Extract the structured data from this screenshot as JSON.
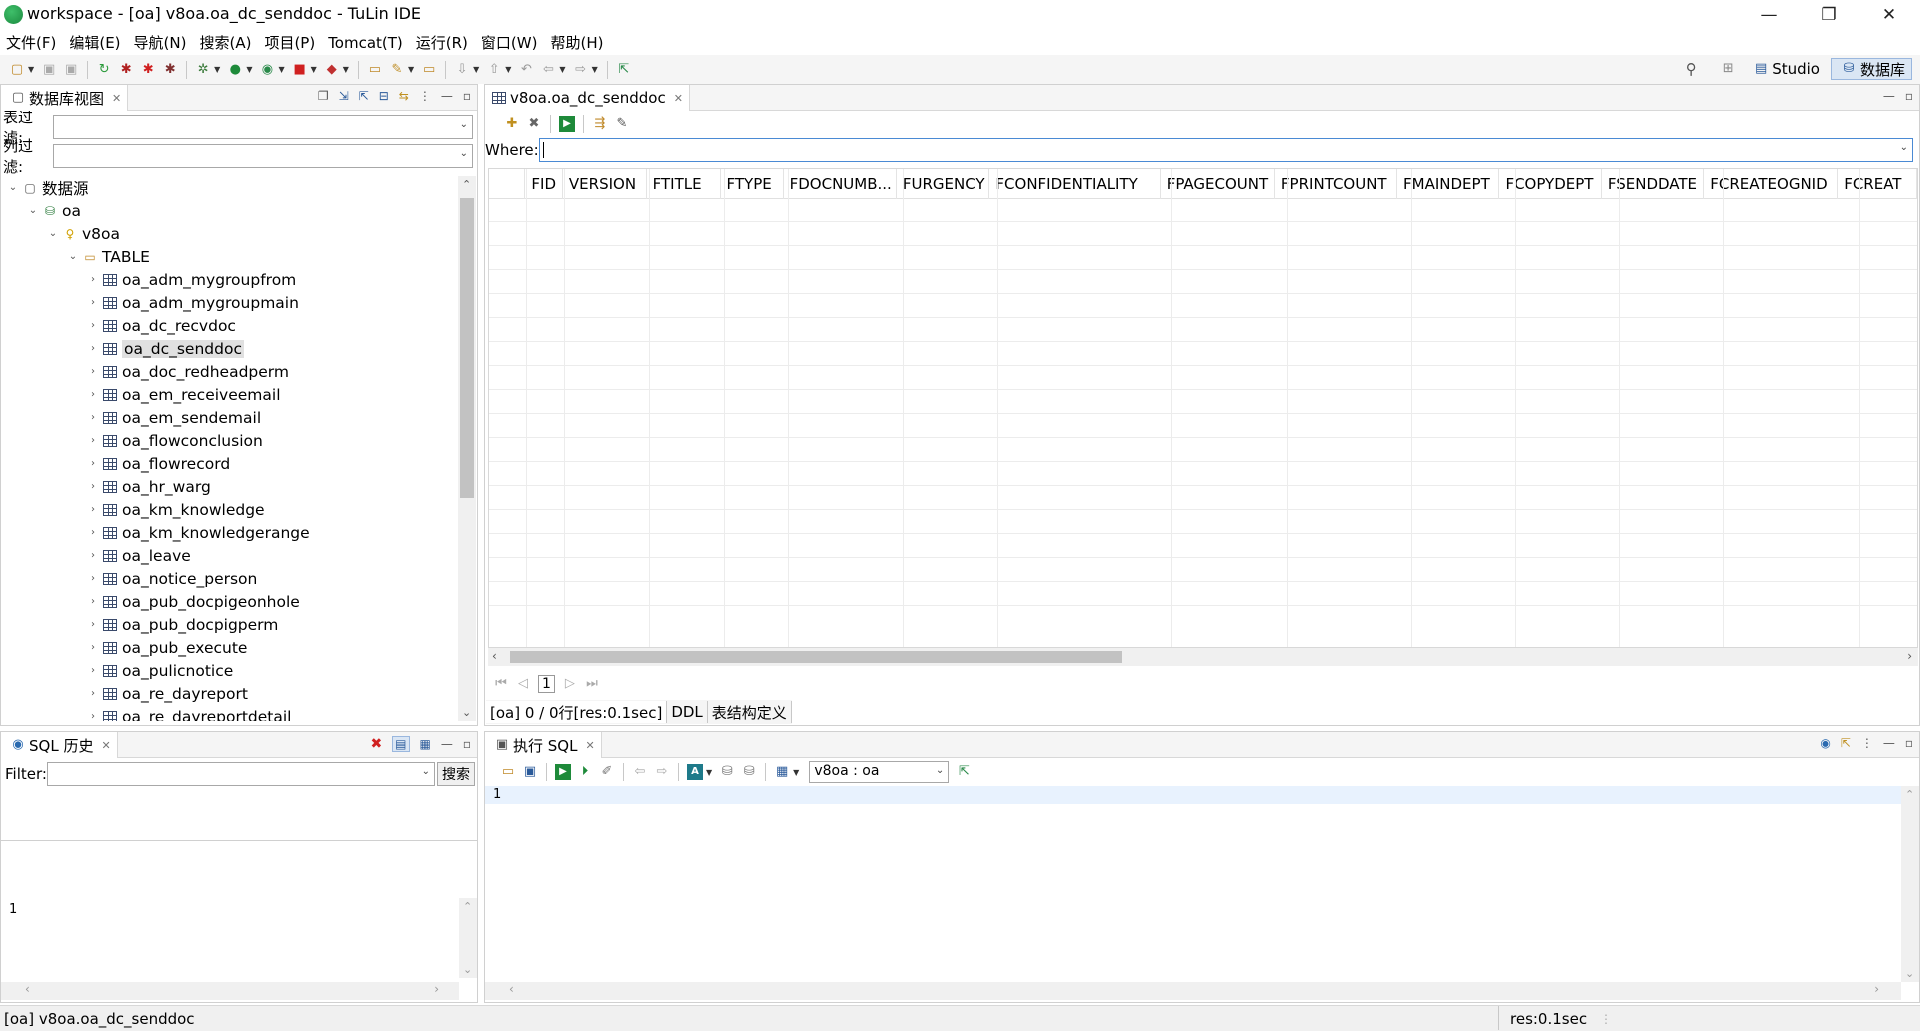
{
  "window": {
    "title": "workspace - [oa] v8oa.oa_dc_senddoc - TuLin IDE",
    "minimize": "—",
    "restore": "❐",
    "close": "✕"
  },
  "menu": [
    "文件(F)",
    "编辑(E)",
    "导航(N)",
    "搜索(A)",
    "项目(P)",
    "Tomcat(T)",
    "运行(R)",
    "窗口(W)",
    "帮助(H)"
  ],
  "perspectives": {
    "studio": "Studio",
    "database": "数据库"
  },
  "db_view": {
    "tab_label": "数据库视图",
    "table_filter_label": "表过滤:",
    "column_filter_label": "列过滤:",
    "tree": {
      "root": "数据源",
      "connection": "oa",
      "schema": "v8oa",
      "folder": "TABLE",
      "tables": [
        "oa_adm_mygroupfrom",
        "oa_adm_mygroupmain",
        "oa_dc_recvdoc",
        "oa_dc_senddoc",
        "oa_doc_redheadperm",
        "oa_em_receiveemail",
        "oa_em_sendemail",
        "oa_flowconclusion",
        "oa_flowrecord",
        "oa_hr_warg",
        "oa_km_knowledge",
        "oa_km_knowledgerange",
        "oa_leave",
        "oa_notice_person",
        "oa_pub_docpigeonhole",
        "oa_pub_docpigperm",
        "oa_pub_execute",
        "oa_pulicnotice",
        "oa_re_dayreport",
        "oa_re_dayreportdetail"
      ],
      "selected_table": "oa_dc_senddoc"
    }
  },
  "editor": {
    "tab_label": "v8oa.oa_dc_senddoc",
    "where_label": "Where:",
    "where_value": "",
    "columns": [
      "FID",
      "VERSION",
      "FTITLE",
      "FTYPE",
      "FDOCNUMB...",
      "FURGENCY",
      "FCONFIDENTIALITY",
      "FPAGECOUNT",
      "FPRINTCOUNT",
      "FMAINDEPT",
      "FCOPYDEPT",
      "FSENDDATE",
      "FCREATEOGNID",
      "FCREAT"
    ],
    "page_number": "1",
    "status_tabs": [
      "[oa] 0 / 0行[res:0.1sec]",
      "DDL",
      "表结构定义"
    ]
  },
  "sql_history": {
    "tab_label": "SQL 历史",
    "filter_label": "Filter:",
    "search_button": "搜索",
    "line_number": "1"
  },
  "exec_sql": {
    "tab_label": "执行 SQL",
    "connection": "v8oa : oa",
    "line_number": "1"
  },
  "statusbar": {
    "left": "[oa] v8oa.oa_dc_senddoc",
    "right": "res:0.1sec"
  }
}
